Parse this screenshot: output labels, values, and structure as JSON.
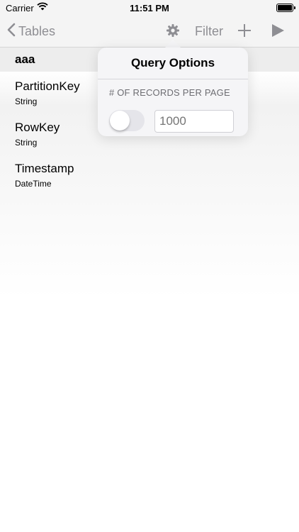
{
  "status_bar": {
    "carrier": "Carrier",
    "time": "11:51 PM"
  },
  "nav": {
    "back_label": "Tables",
    "filter_label": "Filter",
    "icons": [
      "chevron-left-icon",
      "gear-icon",
      "plus-icon",
      "play-icon"
    ],
    "tint_color": "#8e8e93"
  },
  "table": {
    "name": "aaa",
    "columns": [
      {
        "name": "PartitionKey",
        "type": "String"
      },
      {
        "name": "RowKey",
        "type": "String"
      },
      {
        "name": "Timestamp",
        "type": "DateTime"
      }
    ]
  },
  "popover": {
    "title": "Query Options",
    "section_label": "# OF RECORDS PER PAGE",
    "toggle_on": false,
    "records_placeholder": "1000"
  }
}
